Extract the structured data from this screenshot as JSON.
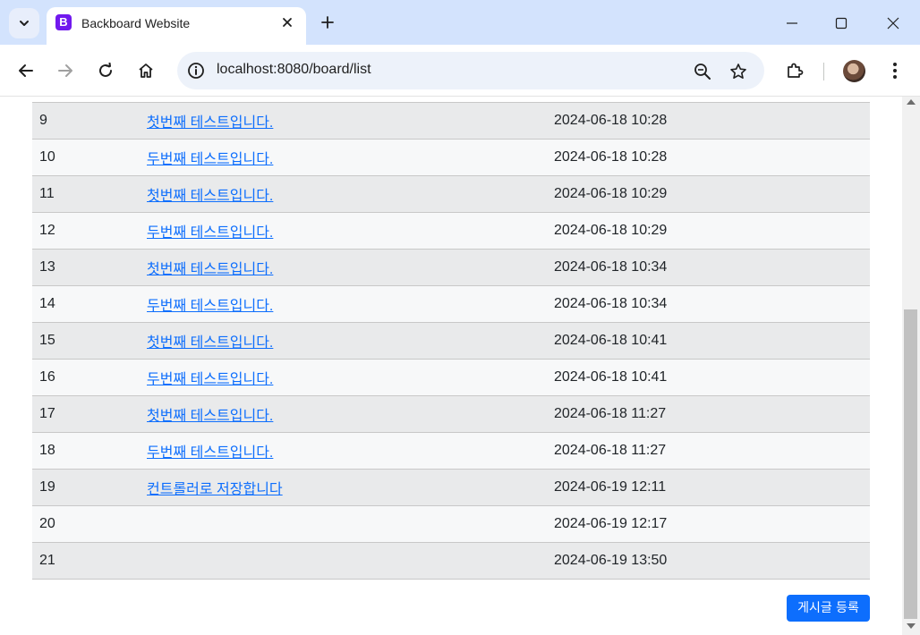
{
  "browser": {
    "tab": {
      "title": "Backboard Website",
      "favicon_letter": "B",
      "favicon_color": "#7119ee"
    },
    "address_bar": {
      "url": "localhost:8080/board/list"
    },
    "icons": {
      "tab_search": "chevron-down-icon",
      "tab_close": "close-icon",
      "new_tab": "plus-icon",
      "minimize": "minimize-icon",
      "maximize": "maximize-icon",
      "close_window": "close-icon",
      "back": "arrow-left-icon",
      "forward": "arrow-right-icon",
      "reload": "reload-icon",
      "home": "home-icon",
      "site_info": "info-icon",
      "zoom": "zoom-icon",
      "bookmark": "star-icon",
      "extensions": "puzzle-icon",
      "profile": "avatar",
      "menu": "kebab-menu-icon"
    }
  },
  "board": {
    "rows": [
      {
        "no": "9",
        "title": "첫번째 테스트입니다.",
        "date": "2024-06-18 10:28"
      },
      {
        "no": "10",
        "title": "두번째 테스트입니다.",
        "date": "2024-06-18 10:28"
      },
      {
        "no": "11",
        "title": "첫번째 테스트입니다.",
        "date": "2024-06-18 10:29"
      },
      {
        "no": "12",
        "title": "두번째 테스트입니다.",
        "date": "2024-06-18 10:29"
      },
      {
        "no": "13",
        "title": "첫번째 테스트입니다.",
        "date": "2024-06-18 10:34"
      },
      {
        "no": "14",
        "title": "두번째 테스트입니다.",
        "date": "2024-06-18 10:34"
      },
      {
        "no": "15",
        "title": "첫번째 테스트입니다.",
        "date": "2024-06-18 10:41"
      },
      {
        "no": "16",
        "title": "두번째 테스트입니다.",
        "date": "2024-06-18 10:41"
      },
      {
        "no": "17",
        "title": "첫번째 테스트입니다.",
        "date": "2024-06-18 11:27"
      },
      {
        "no": "18",
        "title": "두번째 테스트입니다.",
        "date": "2024-06-18 11:27"
      },
      {
        "no": "19",
        "title": "컨트롤러로 저장합니다",
        "date": "2024-06-19 12:11"
      },
      {
        "no": "20",
        "title": "",
        "date": "2024-06-19 12:17"
      },
      {
        "no": "21",
        "title": "",
        "date": "2024-06-19 13:50"
      }
    ],
    "register_label": "게시글 등록"
  },
  "colors": {
    "link": "#0d6efd",
    "button_primary": "#0d6efd",
    "row_odd": "#e9eaeb",
    "row_even": "#f7f8f9",
    "tabstrip": "#d3e3fd"
  }
}
